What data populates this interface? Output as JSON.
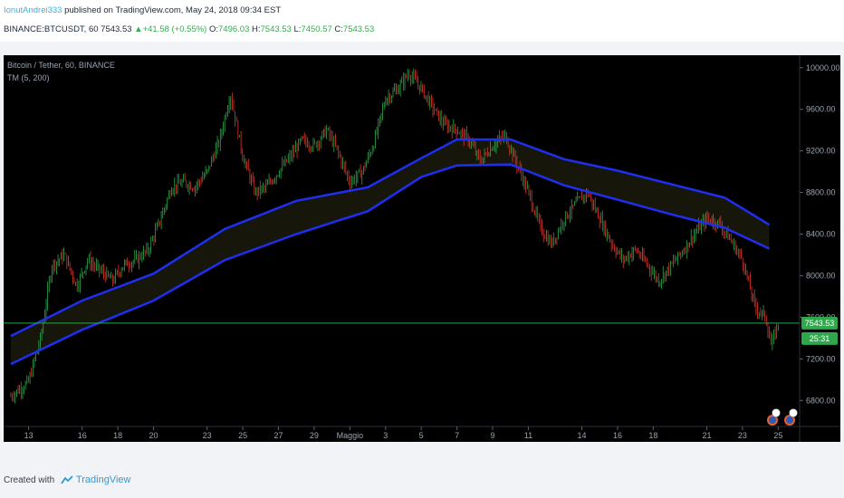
{
  "header": {
    "author": "IonutAndrei333",
    "published_text": " published on TradingView.com, May 24, 2018 09:34 EST",
    "symbol": "BINANCE:BTCUSDT, 60",
    "last": "7543.53",
    "change": "+41.58 (+0.55%)",
    "o_label": "O:",
    "o_value": "7496.03",
    "h_label": "H:",
    "h_value": "7543.53",
    "l_label": "L:",
    "l_value": "7450.57",
    "c_label": "C:",
    "c_value": "7543.53"
  },
  "chart_data": {
    "type": "candlestick",
    "title": "Bitcoin / Tether, 60, BINANCE",
    "indicator": "TM (5, 200)",
    "x_ticks": [
      "13",
      "16",
      "18",
      "20",
      "23",
      "25",
      "27",
      "29",
      "Maggio",
      "3",
      "5",
      "7",
      "9",
      "11",
      "14",
      "16",
      "18",
      "21",
      "23",
      "25"
    ],
    "y_ticks": [
      10000,
      9600,
      9200,
      8800,
      8400,
      8000,
      7600,
      7200,
      6800
    ],
    "y_tick_labels": [
      "10000.00",
      "9600.00",
      "9200.00",
      "8800.00",
      "8400.00",
      "8000.00",
      "7600.00",
      "7200.00",
      "6800.00"
    ],
    "ylim": [
      6550,
      10120
    ],
    "last_price": 7543.53,
    "last_price_label": "7543.53",
    "countdown_label": "25:31",
    "price_path": [
      [
        12,
        6840
      ],
      [
        13,
        6980
      ],
      [
        13.7,
        7420
      ],
      [
        14.3,
        8100
      ],
      [
        15,
        8200
      ],
      [
        15.7,
        7900
      ],
      [
        16.3,
        8150
      ],
      [
        17,
        8050
      ],
      [
        17.7,
        7950
      ],
      [
        18.3,
        8100
      ],
      [
        19,
        8150
      ],
      [
        19.7,
        8250
      ],
      [
        20.3,
        8500
      ],
      [
        21,
        8850
      ],
      [
        21.7,
        8900
      ],
      [
        22.3,
        8850
      ],
      [
        23,
        9000
      ],
      [
        23.7,
        9300
      ],
      [
        24.3,
        9750
      ],
      [
        25,
        9150
      ],
      [
        25.7,
        8800
      ],
      [
        26.3,
        8850
      ],
      [
        27,
        9000
      ],
      [
        27.7,
        9150
      ],
      [
        28.3,
        9300
      ],
      [
        29,
        9250
      ],
      [
        29.7,
        9400
      ],
      [
        30.3,
        9200
      ],
      [
        31,
        8900
      ],
      [
        31.7,
        9000
      ],
      [
        32.3,
        9250
      ],
      [
        33,
        9700
      ],
      [
        33.7,
        9800
      ],
      [
        34.3,
        9950
      ],
      [
        35,
        9800
      ],
      [
        35.7,
        9600
      ],
      [
        36.3,
        9450
      ],
      [
        37,
        9400
      ],
      [
        37.7,
        9300
      ],
      [
        38.3,
        9100
      ],
      [
        39,
        9250
      ],
      [
        39.7,
        9350
      ],
      [
        40.3,
        9100
      ],
      [
        41,
        8800
      ],
      [
        41.7,
        8450
      ],
      [
        42.3,
        8300
      ],
      [
        43,
        8550
      ],
      [
        43.7,
        8700
      ],
      [
        44.3,
        8800
      ],
      [
        45,
        8550
      ],
      [
        45.7,
        8300
      ],
      [
        46.3,
        8150
      ],
      [
        47,
        8250
      ],
      [
        47.7,
        8100
      ],
      [
        48.3,
        7950
      ],
      [
        49,
        8100
      ],
      [
        49.7,
        8250
      ],
      [
        50.3,
        8400
      ],
      [
        51,
        8550
      ],
      [
        51.7,
        8500
      ],
      [
        52.3,
        8350
      ],
      [
        53,
        8150
      ],
      [
        53.7,
        7700
      ],
      [
        54.3,
        7600
      ],
      [
        54.6,
        7320
      ],
      [
        55,
        7543.53
      ]
    ],
    "band_upper": [
      [
        12,
        7420
      ],
      [
        16,
        7760
      ],
      [
        20,
        8020
      ],
      [
        24,
        8450
      ],
      [
        28,
        8720
      ],
      [
        32,
        8850
      ],
      [
        35,
        9130
      ],
      [
        37,
        9310
      ],
      [
        40,
        9310
      ],
      [
        43,
        9120
      ],
      [
        46,
        9010
      ],
      [
        49,
        8880
      ],
      [
        52,
        8750
      ],
      [
        54.5,
        8490
      ]
    ],
    "band_lower": [
      [
        12,
        7150
      ],
      [
        16,
        7480
      ],
      [
        20,
        7760
      ],
      [
        24,
        8150
      ],
      [
        28,
        8400
      ],
      [
        32,
        8620
      ],
      [
        35,
        8950
      ],
      [
        37,
        9060
      ],
      [
        40,
        9070
      ],
      [
        43,
        8870
      ],
      [
        46,
        8730
      ],
      [
        49,
        8590
      ],
      [
        52,
        8460
      ],
      [
        54.5,
        8260
      ]
    ]
  },
  "footer": {
    "created_with": "Created with",
    "brand": "TradingView"
  },
  "colors": {
    "background": "#000000",
    "band_line": "#1f2ff0",
    "band_fill": "#16160a",
    "candle_up": "#2ea84b",
    "candle_down": "#e0372a",
    "price_label_bg": "#2ea84b",
    "axis_text": "#9aa3b2"
  }
}
